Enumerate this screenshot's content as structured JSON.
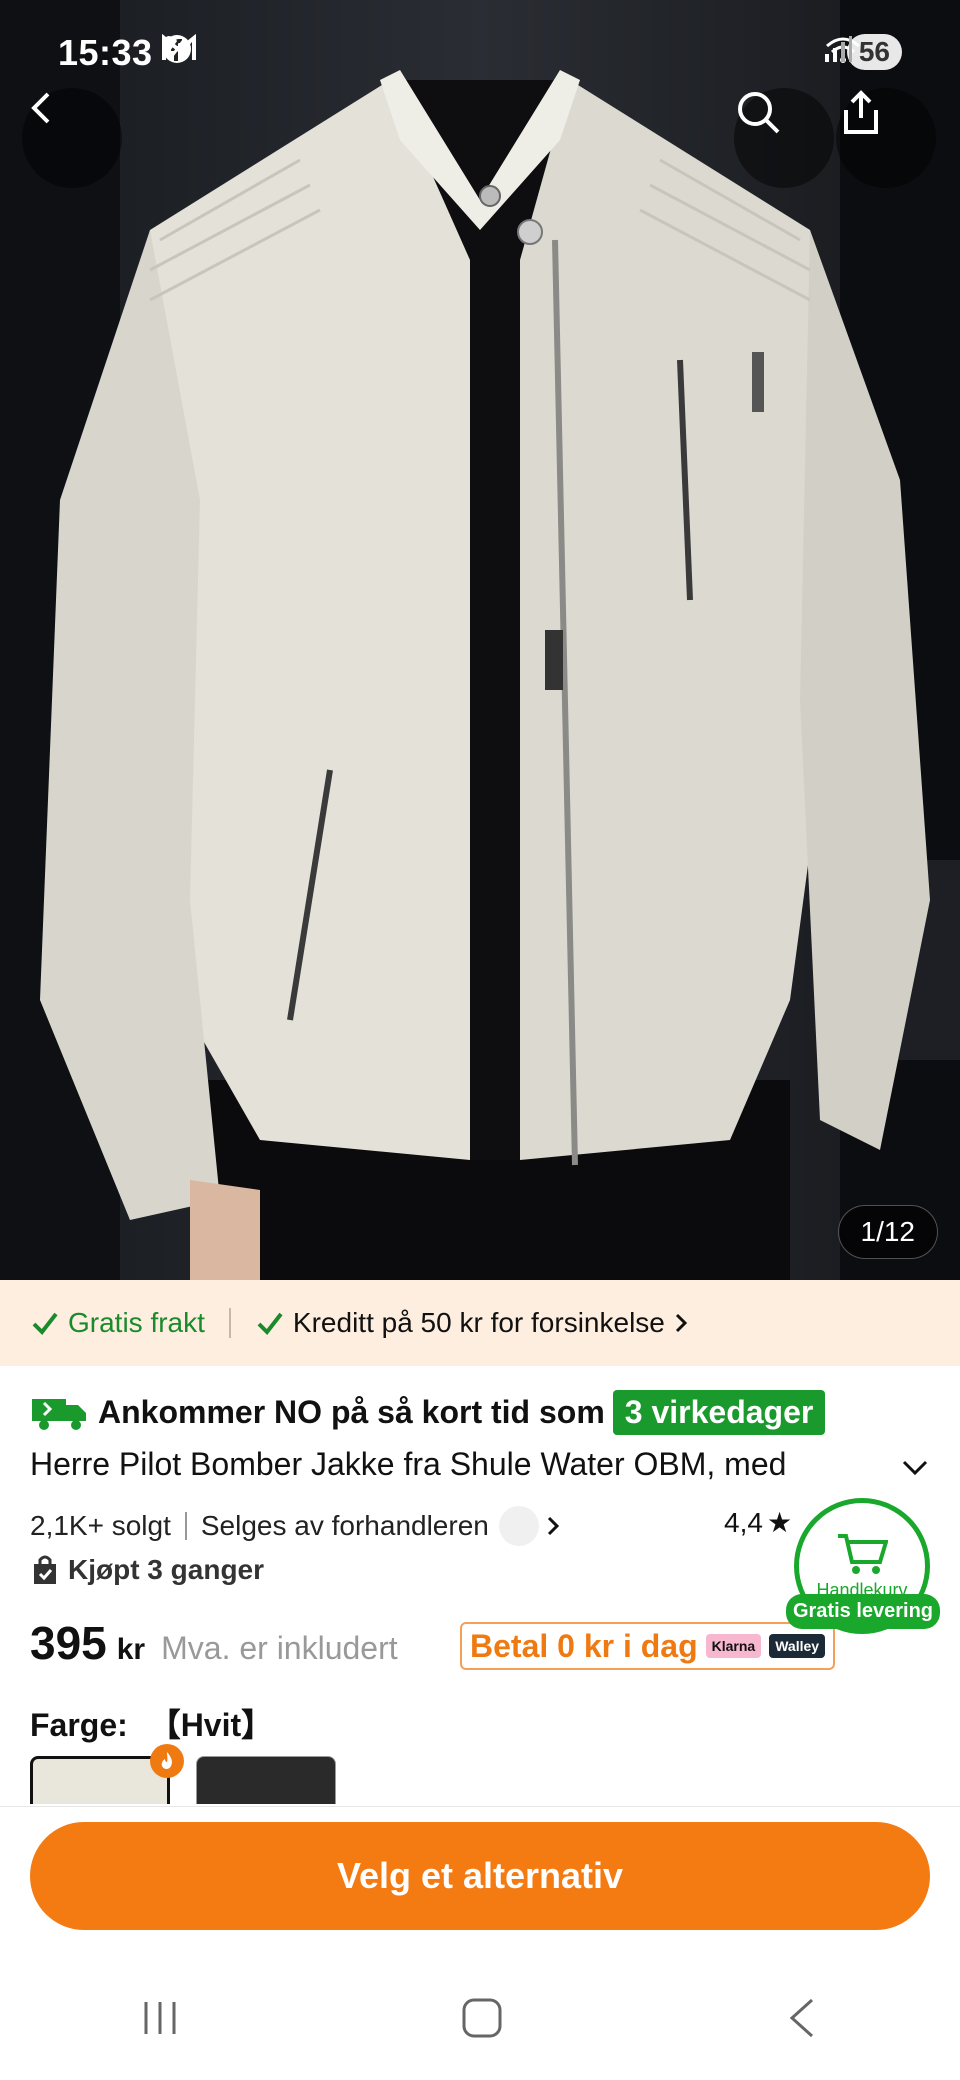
{
  "status_bar": {
    "time": "15:33",
    "battery": "56"
  },
  "hero": {
    "page_counter": "1/12"
  },
  "banner": {
    "free_shipping": "Gratis frakt",
    "credit": "Kreditt på 50 kr for forsinkelse"
  },
  "product": {
    "arrival_text": "Ankommer NO på så kort tid som",
    "arrival_badge": "3 virkedager",
    "title": "Herre Pilot Bomber Jakke fra Shule Water OBM, med",
    "sold": "2,1K+ solgt",
    "seller": "Selges av forhandleren",
    "rating": "4,4",
    "bought": "Kjøpt 3 ganger",
    "price": "395",
    "currency": "kr",
    "vat_note": "Mva. er inkludert",
    "pay_text": "Betal 0 kr i dag",
    "klarna": "Klarna",
    "walley": "Walley",
    "color_label": "Farge:",
    "color_value": "【Hvit】"
  },
  "cart": {
    "label": "Handlekurv",
    "ribbon": "Gratis levering"
  },
  "cta": {
    "label": "Velg et alternativ"
  },
  "colors": {
    "accent": "#f47a12",
    "green": "#1aa82c"
  }
}
